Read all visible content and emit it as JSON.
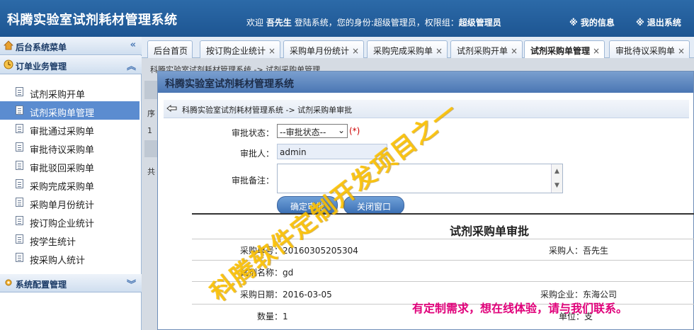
{
  "header": {
    "title": "科腾实验室试剂耗材管理系统",
    "welcome_prefix": "欢迎",
    "user": "吾先生",
    "welcome_suffix": "登陆系统，您的身份:超级管理员，权限组：",
    "group": "超级管理员",
    "my_info": "※ 我的信息",
    "logout": "※ 退出系统"
  },
  "sidebar": {
    "top_panel": "后台系统菜单",
    "order_panel": "订单业务管理",
    "config_panel": "系统配置管理",
    "items": [
      {
        "label": "试剂采购开单"
      },
      {
        "label": "试剂采购单管理"
      },
      {
        "label": "审批通过采购单"
      },
      {
        "label": "审批待议采购单"
      },
      {
        "label": "审批驳回采购单"
      },
      {
        "label": "采购完成采购单"
      },
      {
        "label": "采购单月份统计"
      },
      {
        "label": "按订购企业统计"
      },
      {
        "label": "按学生统计"
      },
      {
        "label": "按采购人统计"
      }
    ],
    "active_index": 1
  },
  "tabs": [
    {
      "label": "后台首页",
      "closable": false
    },
    {
      "label": "按订购企业统计",
      "closable": true
    },
    {
      "label": "采购单月份统计",
      "closable": true
    },
    {
      "label": "采购完成采购单",
      "closable": true
    },
    {
      "label": "试剂采购开单",
      "closable": true
    },
    {
      "label": "试剂采购单管理",
      "closable": true,
      "active": true
    },
    {
      "label": "审批待议采购单",
      "closable": true
    }
  ],
  "background": {
    "crumb": "科腾实验室试剂耗材管理系统 -> 试剂采购单管理",
    "col_head": "序",
    "row1": "1",
    "footer": "共"
  },
  "dialog": {
    "title": "科腾实验室试剂耗材管理系统",
    "crumb": "科腾实验室试剂耗材管理系统 -> 试剂采购单审批",
    "status_label": "审批状态：",
    "status_value": "--审批状态--",
    "required_mark": "(*)",
    "approver_label": "审批人：",
    "approver_value": "admin",
    "remark_label": "审批备注：",
    "confirm_button": "确定审批",
    "close_button": "关闭窗口",
    "report_title": "试剂采购单审批",
    "fields": {
      "order_no": "采购单号：20160305205304",
      "purchaser": "采购人：吾先生",
      "reagent_name": "试剂名称：gd",
      "purchase_date": "采购日期：2016-03-05",
      "supplier": "采购企业：东海公司",
      "quantity": "数量：1",
      "unit": "单位：支"
    }
  },
  "watermark": "科腾软件定制开发项目之一",
  "promo": "有定制需求，想在线体验，请与我们联系。"
}
